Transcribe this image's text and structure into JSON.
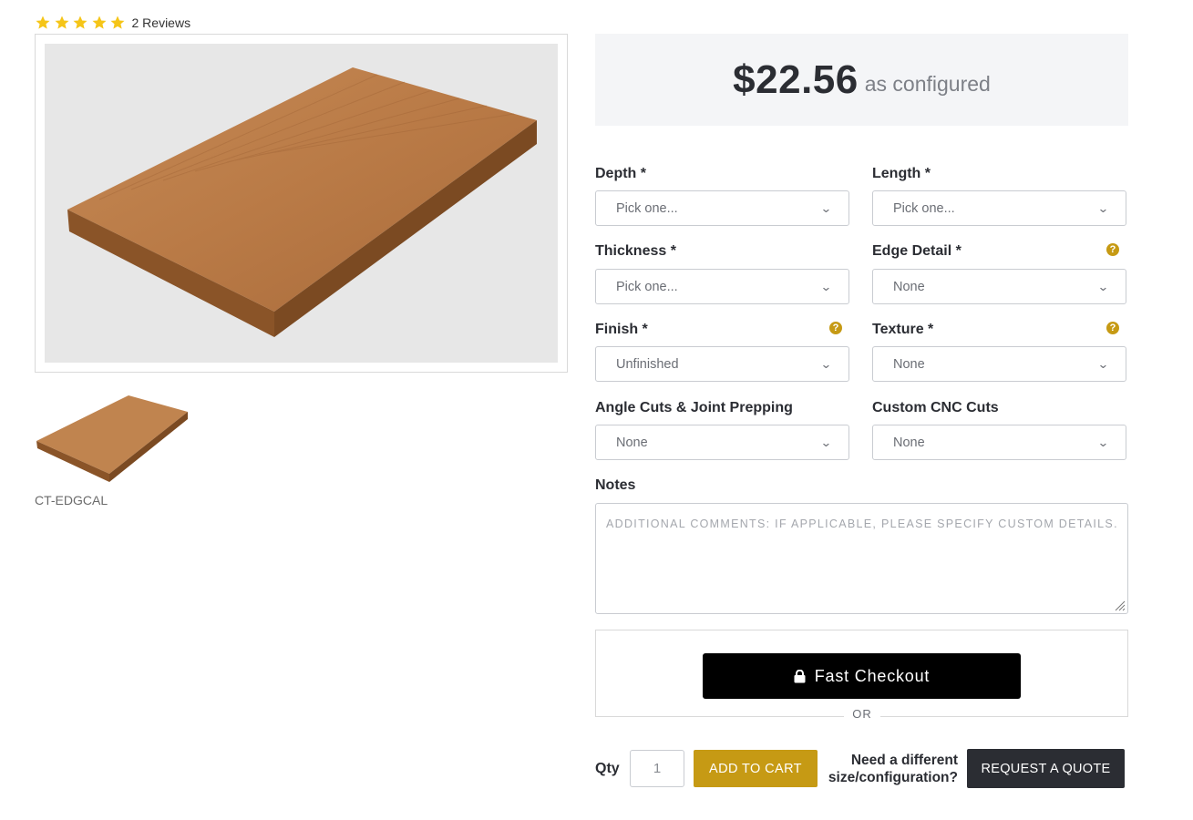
{
  "rating": {
    "stars": 5,
    "max_stars": 5,
    "reviews_text": "2 Reviews",
    "star_color": "#f5c518"
  },
  "product": {
    "sku": "CT-EDGCAL",
    "wood_color": "#b7794a"
  },
  "price": {
    "amount": "$22.56",
    "suffix": "as configured"
  },
  "fields": [
    {
      "label": "Depth *",
      "value": "Pick one...",
      "help": false
    },
    {
      "label": "Length *",
      "value": "Pick one...",
      "help": false
    },
    {
      "label": "Thickness *",
      "value": "Pick one...",
      "help": false
    },
    {
      "label": "Edge Detail *",
      "value": "None",
      "help": true
    },
    {
      "label": "Finish *",
      "value": "Unfinished",
      "help": true
    },
    {
      "label": "Texture *",
      "value": "None",
      "help": true
    },
    {
      "label": "Angle Cuts & Joint Prepping",
      "value": "None",
      "help": false
    },
    {
      "label": "Custom CNC Cuts",
      "value": "None",
      "help": false
    }
  ],
  "help_glyph": "?",
  "chevron": "⌄",
  "notes": {
    "label": "Notes",
    "placeholder": "ADDITIONAL COMMENTS: IF APPLICABLE, PLEASE SPECIFY CUSTOM DETAILS."
  },
  "checkout": {
    "fast_checkout_label": "Fast Checkout",
    "or_label": "OR"
  },
  "purchase": {
    "qty_label": "Qty",
    "qty_value": "1",
    "add_to_cart_label": "ADD TO CART",
    "need_line1": "Need a different",
    "need_line2": "size/configuration?",
    "request_quote_label": "REQUEST A QUOTE"
  },
  "colors": {
    "accent": "#c69a14",
    "dark": "#2b2d33",
    "price_bg": "#f4f5f7"
  }
}
